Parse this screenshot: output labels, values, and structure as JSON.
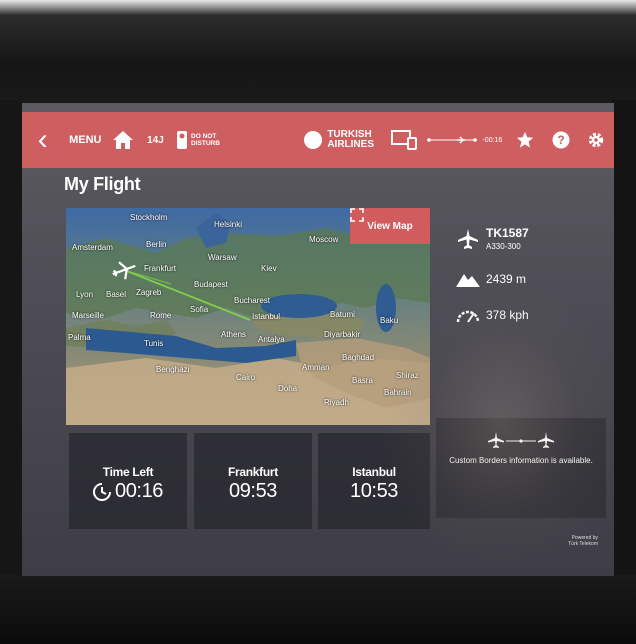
{
  "topbar": {
    "menu_label": "MENU",
    "seat": "14J",
    "do_not_disturb_line1": "DO NOT",
    "do_not_disturb_line2": "DISTURB",
    "airline_line1": "TURKISH",
    "airline_line2": "AIRLINES",
    "time_to_go": "-00:16",
    "bar_color": "#cf5e61"
  },
  "page": {
    "title": "My Flight"
  },
  "map": {
    "view_map_label": "View Map",
    "cities": [
      "Stockholm",
      "Helsinki",
      "Amsterdam",
      "Berlin",
      "Warsaw",
      "Moscow",
      "Frankfurt",
      "Kiev",
      "Lyon",
      "Basel",
      "Zagreb",
      "Budapest",
      "Marseille",
      "Rome",
      "Sofia",
      "Bucharest",
      "Palma",
      "Athens",
      "Istanbul",
      "Batumi",
      "Baku",
      "Tunis",
      "Antalya",
      "Diyarbakir",
      "Benghazi",
      "Baghdad",
      "Amman",
      "Cairo",
      "Basra",
      "Shiraz",
      "Doha",
      "Bahrain",
      "Riyadh"
    ],
    "route_color": "#7fd04a"
  },
  "flight": {
    "number": "TK1587",
    "aircraft": "A330-300",
    "altitude": "2439 m",
    "speed": "378 kph",
    "borders_info": "Custom Borders information is available."
  },
  "panels": {
    "time_left_label": "Time Left",
    "time_left_value": "00:16",
    "origin_label": "Frankfurt",
    "origin_time": "09:53",
    "destination_label": "Istanbul",
    "destination_time": "10:53"
  },
  "footer": {
    "powered_line1": "Powered by",
    "powered_line2": "Türk Telekom"
  }
}
